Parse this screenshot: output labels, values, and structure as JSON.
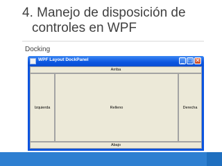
{
  "slide": {
    "title_line1": "4. Manejo de disposición de",
    "title_line2": "controles en WPF",
    "subtitle": "Docking"
  },
  "window": {
    "title": "WPF Layout DockPanel",
    "buttons": {
      "minimize": "_",
      "maximize": "□",
      "close": "✕"
    }
  },
  "dock": {
    "top": "Arriba",
    "left": "Izquierda",
    "center": "Relleno",
    "right": "Derecha",
    "bottom": "Abajo"
  },
  "colors": {
    "title_text": "#404040",
    "window_frame": "#0a54e0",
    "client_bg": "#ece9d8",
    "bottom_bar": "#2e7fd1"
  }
}
